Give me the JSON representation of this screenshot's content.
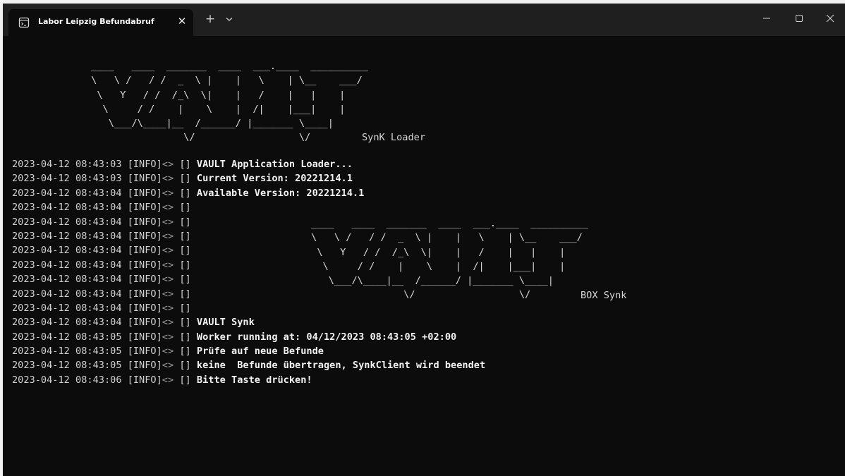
{
  "window": {
    "tab_title": "Labor Leipzig Befundabruf",
    "tab_close": "✕",
    "new_tab": "+",
    "controls": {
      "minimize_icon": "minimize-icon",
      "maximize_icon": "maximize-icon",
      "close_icon": "close-icon"
    }
  },
  "terminal": {
    "banner_top": {
      "art": " ____   ____  _______  ____  ___.____  __________\n \\   \\ /   / /  _  \\ |    |   \\    | \\__    ___/\n  \\   Y   / /  /_\\  \\|    |   /    |   |    |\n   \\     / /    |    \\    |  /|    |___|    |\n    \\___/\\____|__  /______/ |_______ \\____|\n                 \\/                  \\/  ",
      "caption": "SynK Loader"
    },
    "banner_box": {
      "art": " ____   ____  _______  ____  ___.____  __________\n \\   \\ /   / /  _  \\ |    |   \\    | \\__    ___/\n  \\   Y   / /  /_\\  \\|    |   /    |   |    |\n   \\     / /    |    \\    |  /|    |___|    |\n    \\___/\\____|__  /______/ |_______ \\____|\n                 \\/                  \\/  ",
      "caption": "BOX Synk"
    },
    "log_lines": [
      {
        "timestamp": "2023-04-12 08:43:03",
        "level": "[INFO]",
        "sep": "<>",
        "bracket": "[]",
        "message": "VAULT Application Loader..."
      },
      {
        "timestamp": "2023-04-12 08:43:03",
        "level": "[INFO]",
        "sep": "<>",
        "bracket": "[]",
        "message": "Current Version: 20221214.1"
      },
      {
        "timestamp": "2023-04-12 08:43:04",
        "level": "[INFO]",
        "sep": "<>",
        "bracket": "[]",
        "message": "Available Version: 20221214.1"
      },
      {
        "timestamp": "2023-04-12 08:43:04",
        "level": "[INFO]",
        "sep": "<>",
        "bracket": "[]",
        "message": ""
      },
      {
        "timestamp": "2023-04-12 08:43:04",
        "level": "[INFO]",
        "sep": "<>",
        "bracket": "[]",
        "message": ""
      },
      {
        "timestamp": "2023-04-12 08:43:04",
        "level": "[INFO]",
        "sep": "<>",
        "bracket": "[]",
        "message": ""
      },
      {
        "timestamp": "2023-04-12 08:43:04",
        "level": "[INFO]",
        "sep": "<>",
        "bracket": "[]",
        "message": ""
      },
      {
        "timestamp": "2023-04-12 08:43:04",
        "level": "[INFO]",
        "sep": "<>",
        "bracket": "[]",
        "message": ""
      },
      {
        "timestamp": "2023-04-12 08:43:04",
        "level": "[INFO]",
        "sep": "<>",
        "bracket": "[]",
        "message": ""
      },
      {
        "timestamp": "2023-04-12 08:43:04",
        "level": "[INFO]",
        "sep": "<>",
        "bracket": "[]",
        "message": ""
      },
      {
        "timestamp": "2023-04-12 08:43:04",
        "level": "[INFO]",
        "sep": "<>",
        "bracket": "[]",
        "message": ""
      },
      {
        "timestamp": "2023-04-12 08:43:04",
        "level": "[INFO]",
        "sep": "<>",
        "bracket": "[]",
        "message": "VAULT Synk"
      },
      {
        "timestamp": "2023-04-12 08:43:05",
        "level": "[INFO]",
        "sep": "<>",
        "bracket": "[]",
        "message": "Worker running at: 04/12/2023 08:43:05 +02:00"
      },
      {
        "timestamp": "2023-04-12 08:43:05",
        "level": "[INFO]",
        "sep": "<>",
        "bracket": "[]",
        "message": "Prüfe auf neue Befunde"
      },
      {
        "timestamp": "2023-04-12 08:43:05",
        "level": "[INFO]",
        "sep": "<>",
        "bracket": "[]",
        "message": "keine  Befunde übertragen, SynkClient wird beendet"
      },
      {
        "timestamp": "2023-04-12 08:43:06",
        "level": "[INFO]",
        "sep": "<>",
        "bracket": "[]",
        "message": "Bitte Taste drücken!"
      }
    ]
  },
  "colors": {
    "terminal_bg": "#0c0c0c",
    "titlebar_bg": "#1f1f1f",
    "text": "#d8d8d8",
    "text_bright": "#f2f2f2"
  }
}
